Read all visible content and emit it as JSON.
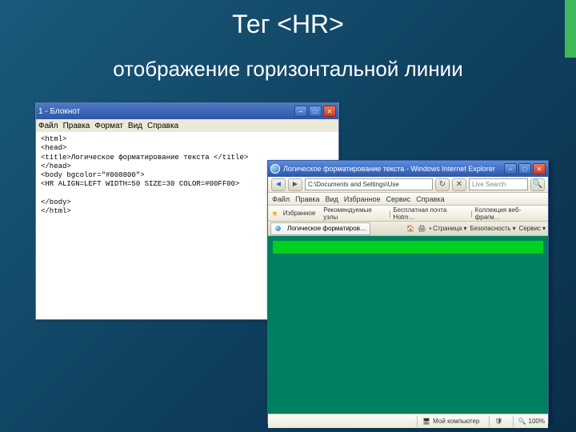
{
  "slide": {
    "title": "Тег <HR>",
    "subtitle": "отображение горизонтальной линии"
  },
  "editor": {
    "title": "1 - Блокнот",
    "menu": [
      "Файл",
      "Правка",
      "Формат",
      "Вид",
      "Справка"
    ],
    "content": "<html>\n<head>\n<title>Логическое форматирование текста </title>\n</head>\n<body bgcolor=\"#008800\">\n<HR ALIGN=LEFT WIDTH=50 SIZE=30 COLOR=#00FF00>\n\n</body>\n</html>"
  },
  "browser": {
    "title": "Логическое форматирование текста - Windows Internet Explorer",
    "address": "C:\\Documents and Settings\\Use",
    "search_placeholder": "Live Search",
    "menu": [
      "Файл",
      "Правка",
      "Вид",
      "Избранное",
      "Сервис",
      "Справка"
    ],
    "favorites_label": "Избранное",
    "fav_items": [
      "Рекомендуемые узлы",
      "Бесплатная почта Hotm…",
      "Коллекция веб-фрагм…"
    ],
    "tab_label": "Логическое форматиров…",
    "toolbar": [
      "Страница",
      "Безопасность",
      "Сервис"
    ],
    "status": {
      "zone": "Мой компьютер",
      "zoom": "100%"
    }
  }
}
